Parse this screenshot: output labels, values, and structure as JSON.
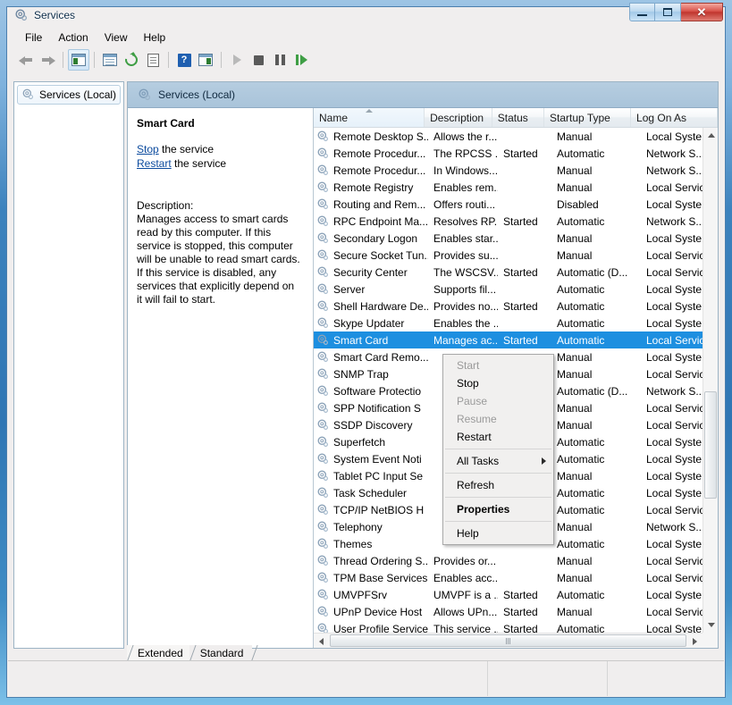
{
  "window": {
    "title": "Services",
    "icon": "services-gear-icon",
    "buttons": {
      "minimize": "Minimize",
      "maximize": "Maximize",
      "close": "Close"
    }
  },
  "menubar": {
    "items": [
      {
        "label": "File",
        "name": "menu-file"
      },
      {
        "label": "Action",
        "name": "menu-action"
      },
      {
        "label": "View",
        "name": "menu-view"
      },
      {
        "label": "Help",
        "name": "menu-help"
      }
    ]
  },
  "toolbar": {
    "buttons": [
      {
        "name": "back-arrow-icon",
        "title": "Back"
      },
      {
        "name": "forward-arrow-icon",
        "title": "Forward"
      },
      {
        "name": "show-hide-console-tree-icon",
        "title": "Show/Hide Console Tree"
      },
      {
        "name": "properties-icon",
        "title": "Properties"
      },
      {
        "name": "refresh-icon",
        "title": "Refresh"
      },
      {
        "name": "export-list-icon",
        "title": "Export List"
      },
      {
        "name": "help-icon",
        "title": "Help"
      },
      {
        "name": "show-hide-action-pane-icon",
        "title": "Show/Hide Action Pane"
      },
      {
        "name": "start-service-icon",
        "title": "Start Service"
      },
      {
        "name": "stop-service-icon",
        "title": "Stop Service"
      },
      {
        "name": "pause-service-icon",
        "title": "Pause Service"
      },
      {
        "name": "restart-service-icon",
        "title": "Restart Service"
      }
    ]
  },
  "tree": {
    "root_label": "Services (Local)"
  },
  "main": {
    "header_label": "Services (Local)"
  },
  "details": {
    "service_name": "Smart Card",
    "actions": [
      {
        "link": "Stop",
        "rest": " the service"
      },
      {
        "link": "Restart",
        "rest": " the service"
      }
    ],
    "description_label": "Description:",
    "description": "Manages access to smart cards read by this computer. If this service is stopped, this computer will be unable to read smart cards. If this service is disabled, any services that explicitly depend on it will fail to start."
  },
  "list": {
    "columns": [
      {
        "label": "Name",
        "key": "name",
        "sorted": true,
        "sort_direction": "ascending"
      },
      {
        "label": "Description",
        "key": "description",
        "sorted": false
      },
      {
        "label": "Status",
        "key": "status",
        "sorted": false
      },
      {
        "label": "Startup Type",
        "key": "startup_type",
        "sorted": false
      },
      {
        "label": "Log On As",
        "key": "log_on_as",
        "sorted": false
      }
    ],
    "selected_row_index": 12,
    "rows": [
      {
        "name": "Remote Desktop S...",
        "description": "Allows the r...",
        "status": "",
        "startup_type": "Manual",
        "log_on_as": "Local Syste..."
      },
      {
        "name": "Remote Procedur...",
        "description": "The RPCSS ...",
        "status": "Started",
        "startup_type": "Automatic",
        "log_on_as": "Network S..."
      },
      {
        "name": "Remote Procedur...",
        "description": "In Windows...",
        "status": "",
        "startup_type": "Manual",
        "log_on_as": "Network S..."
      },
      {
        "name": "Remote Registry",
        "description": "Enables rem...",
        "status": "",
        "startup_type": "Manual",
        "log_on_as": "Local Service"
      },
      {
        "name": "Routing and Rem...",
        "description": "Offers routi...",
        "status": "",
        "startup_type": "Disabled",
        "log_on_as": "Local Syste..."
      },
      {
        "name": "RPC Endpoint Ma...",
        "description": "Resolves RP...",
        "status": "Started",
        "startup_type": "Automatic",
        "log_on_as": "Network S..."
      },
      {
        "name": "Secondary Logon",
        "description": "Enables star...",
        "status": "",
        "startup_type": "Manual",
        "log_on_as": "Local Syste..."
      },
      {
        "name": "Secure Socket Tun...",
        "description": "Provides su...",
        "status": "",
        "startup_type": "Manual",
        "log_on_as": "Local Service"
      },
      {
        "name": "Security Center",
        "description": "The WSCSV...",
        "status": "Started",
        "startup_type": "Automatic (D...",
        "log_on_as": "Local Service"
      },
      {
        "name": "Server",
        "description": "Supports fil...",
        "status": "",
        "startup_type": "Automatic",
        "log_on_as": "Local Syste..."
      },
      {
        "name": "Shell Hardware De...",
        "description": "Provides no...",
        "status": "Started",
        "startup_type": "Automatic",
        "log_on_as": "Local Syste..."
      },
      {
        "name": "Skype Updater",
        "description": "Enables the ...",
        "status": "",
        "startup_type": "Automatic",
        "log_on_as": "Local Syste..."
      },
      {
        "name": "Smart Card",
        "description": "Manages ac...",
        "status": "Started",
        "startup_type": "Automatic",
        "log_on_as": "Local Service"
      },
      {
        "name": "Smart Card Remo...",
        "description": "",
        "status": "",
        "startup_type": "Manual",
        "log_on_as": "Local Syste..."
      },
      {
        "name": "SNMP Trap",
        "description": "",
        "status": "",
        "startup_type": "Manual",
        "log_on_as": "Local Service"
      },
      {
        "name": "Software Protectio",
        "description": "",
        "status": "",
        "startup_type": "Automatic (D...",
        "log_on_as": "Network S..."
      },
      {
        "name": "SPP Notification S",
        "description": "",
        "status": "",
        "startup_type": "Manual",
        "log_on_as": "Local Service"
      },
      {
        "name": "SSDP Discovery",
        "description": "",
        "status": "",
        "startup_type": "Manual",
        "log_on_as": "Local Service"
      },
      {
        "name": "Superfetch",
        "description": "",
        "status": "",
        "startup_type": "Automatic",
        "log_on_as": "Local Syste..."
      },
      {
        "name": "System Event Noti",
        "description": "",
        "status": "",
        "startup_type": "Automatic",
        "log_on_as": "Local Syste..."
      },
      {
        "name": "Tablet PC Input Se",
        "description": "",
        "status": "",
        "startup_type": "Manual",
        "log_on_as": "Local Syste..."
      },
      {
        "name": "Task Scheduler",
        "description": "",
        "status": "",
        "startup_type": "Automatic",
        "log_on_as": "Local Syste..."
      },
      {
        "name": "TCP/IP NetBIOS H",
        "description": "",
        "status": "",
        "startup_type": "Automatic",
        "log_on_as": "Local Service"
      },
      {
        "name": "Telephony",
        "description": "",
        "status": "",
        "startup_type": "Manual",
        "log_on_as": "Network S..."
      },
      {
        "name": "Themes",
        "description": "",
        "status": "",
        "startup_type": "Automatic",
        "log_on_as": "Local Syste..."
      },
      {
        "name": "Thread Ordering S...",
        "description": "Provides or...",
        "status": "",
        "startup_type": "Manual",
        "log_on_as": "Local Service"
      },
      {
        "name": "TPM Base Services",
        "description": "Enables acc...",
        "status": "",
        "startup_type": "Manual",
        "log_on_as": "Local Service"
      },
      {
        "name": "UMVPFSrv",
        "description": "UMVPF is a ...",
        "status": "Started",
        "startup_type": "Automatic",
        "log_on_as": "Local Syste..."
      },
      {
        "name": "UPnP Device Host",
        "description": "Allows UPn...",
        "status": "Started",
        "startup_type": "Manual",
        "log_on_as": "Local Service"
      },
      {
        "name": "User Profile Service",
        "description": "This service ...",
        "status": "Started",
        "startup_type": "Automatic",
        "log_on_as": "Local Syste..."
      }
    ]
  },
  "context_menu": {
    "items": [
      {
        "label": "Start",
        "disabled": true,
        "bold": false,
        "submenu": false,
        "name": "ctx-start"
      },
      {
        "label": "Stop",
        "disabled": false,
        "bold": false,
        "submenu": false,
        "name": "ctx-stop"
      },
      {
        "label": "Pause",
        "disabled": true,
        "bold": false,
        "submenu": false,
        "name": "ctx-pause"
      },
      {
        "label": "Resume",
        "disabled": true,
        "bold": false,
        "submenu": false,
        "name": "ctx-resume"
      },
      {
        "label": "Restart",
        "disabled": false,
        "bold": false,
        "submenu": false,
        "name": "ctx-restart"
      },
      {
        "separator": true
      },
      {
        "label": "All Tasks",
        "disabled": false,
        "bold": false,
        "submenu": true,
        "name": "ctx-all-tasks"
      },
      {
        "separator": true
      },
      {
        "label": "Refresh",
        "disabled": false,
        "bold": false,
        "submenu": false,
        "name": "ctx-refresh"
      },
      {
        "separator": true
      },
      {
        "label": "Properties",
        "disabled": false,
        "bold": true,
        "submenu": false,
        "name": "ctx-properties"
      },
      {
        "separator": true
      },
      {
        "label": "Help",
        "disabled": false,
        "bold": false,
        "submenu": false,
        "name": "ctx-help"
      }
    ]
  },
  "tabs": {
    "items": [
      {
        "label": "Extended",
        "active": true,
        "name": "tab-extended"
      },
      {
        "label": "Standard",
        "active": false,
        "name": "tab-standard"
      }
    ]
  },
  "colors": {
    "selection": "#1d8fe0",
    "link": "#0c4b9e",
    "close_button": "#c0352e",
    "titlebar_glass": "#3c82bd"
  }
}
